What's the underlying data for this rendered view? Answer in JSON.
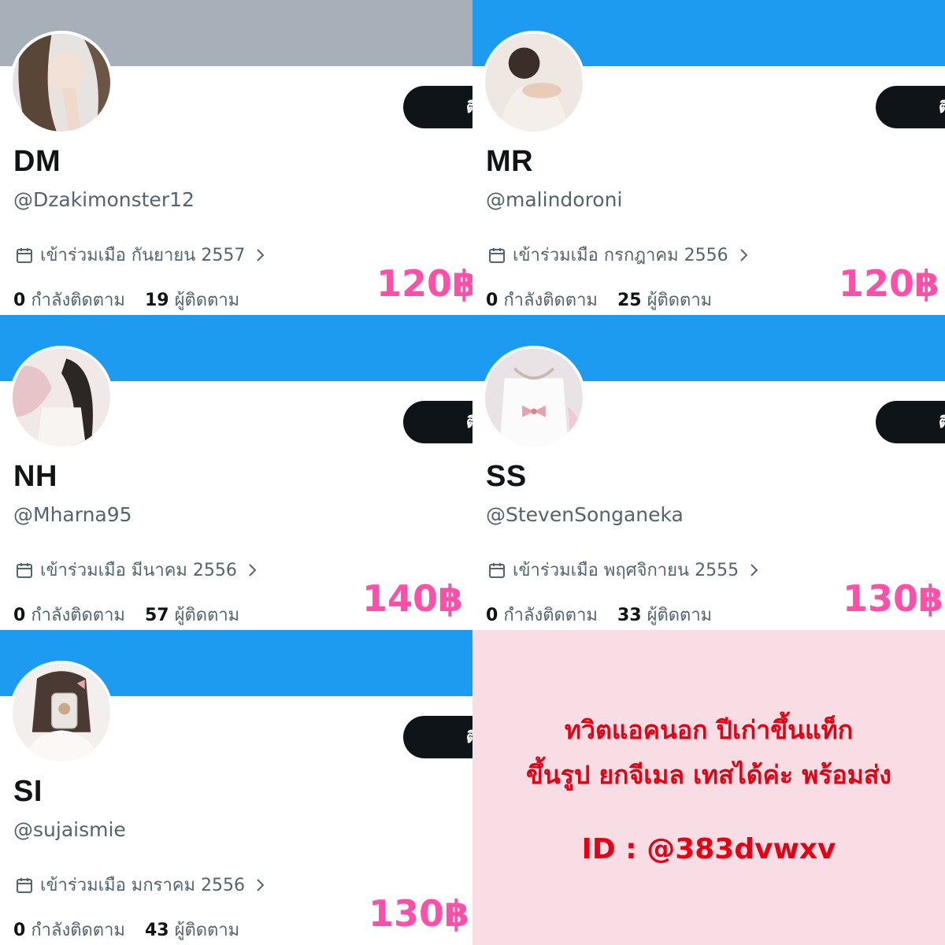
{
  "follow_button_label": "ติ",
  "cards": [
    {
      "name": "DM",
      "handle": "@Dzakimonster12",
      "joined": "เข้าร่วมเมือ กันยายน 2557",
      "following_count": "0",
      "following_label": "กำลังติดตาม",
      "followers_count": "19",
      "followers_label": "ผู้ติดตาม",
      "price": "120฿",
      "banner_color": "#a7b0b9"
    },
    {
      "name": "MR",
      "handle": "@malindoroni",
      "joined": "เข้าร่วมเมือ กรกฎาคม 2556",
      "following_count": "0",
      "following_label": "กำลังติดตาม",
      "followers_count": "25",
      "followers_label": "ผู้ติดตาม",
      "price": "120฿",
      "banner_color": "#1d9bf0"
    },
    {
      "name": "NH",
      "handle": "@Mharna95",
      "joined": "เข้าร่วมเมือ มีนาคม 2556",
      "following_count": "0",
      "following_label": "กำลังติดตาม",
      "followers_count": "57",
      "followers_label": "ผู้ติดตาม",
      "price": "140฿",
      "banner_color": "#1d9bf0"
    },
    {
      "name": "SS",
      "handle": "@StevenSonganeka",
      "joined": "เข้าร่วมเมือ พฤศจิกายน 2555",
      "following_count": "0",
      "following_label": "กำลังติดตาม",
      "followers_count": "33",
      "followers_label": "ผู้ติดตาม",
      "price": "130฿",
      "banner_color": "#1d9bf0"
    },
    {
      "name": "SI",
      "handle": "@sujaismie",
      "joined": "เข้าร่วมเมือ มกราคม 2556",
      "following_count": "0",
      "following_label": "กำลังติดตาม",
      "followers_count": "43",
      "followers_label": "ผู้ติดตาม",
      "price": "130฿",
      "banner_color": "#1d9bf0"
    }
  ],
  "promo": {
    "line1": "ทวิตแอคนอก ปีเก่าขึ้นแท็ก",
    "line2": "ขึ้นรูป ยกจีเมล เทสได้ค่ะ พร้อมส่ง",
    "line3": "ID : @383dvwxv",
    "background": "#f9dde5",
    "text_color": "#e60012"
  },
  "price_color": "#ff4fa8"
}
